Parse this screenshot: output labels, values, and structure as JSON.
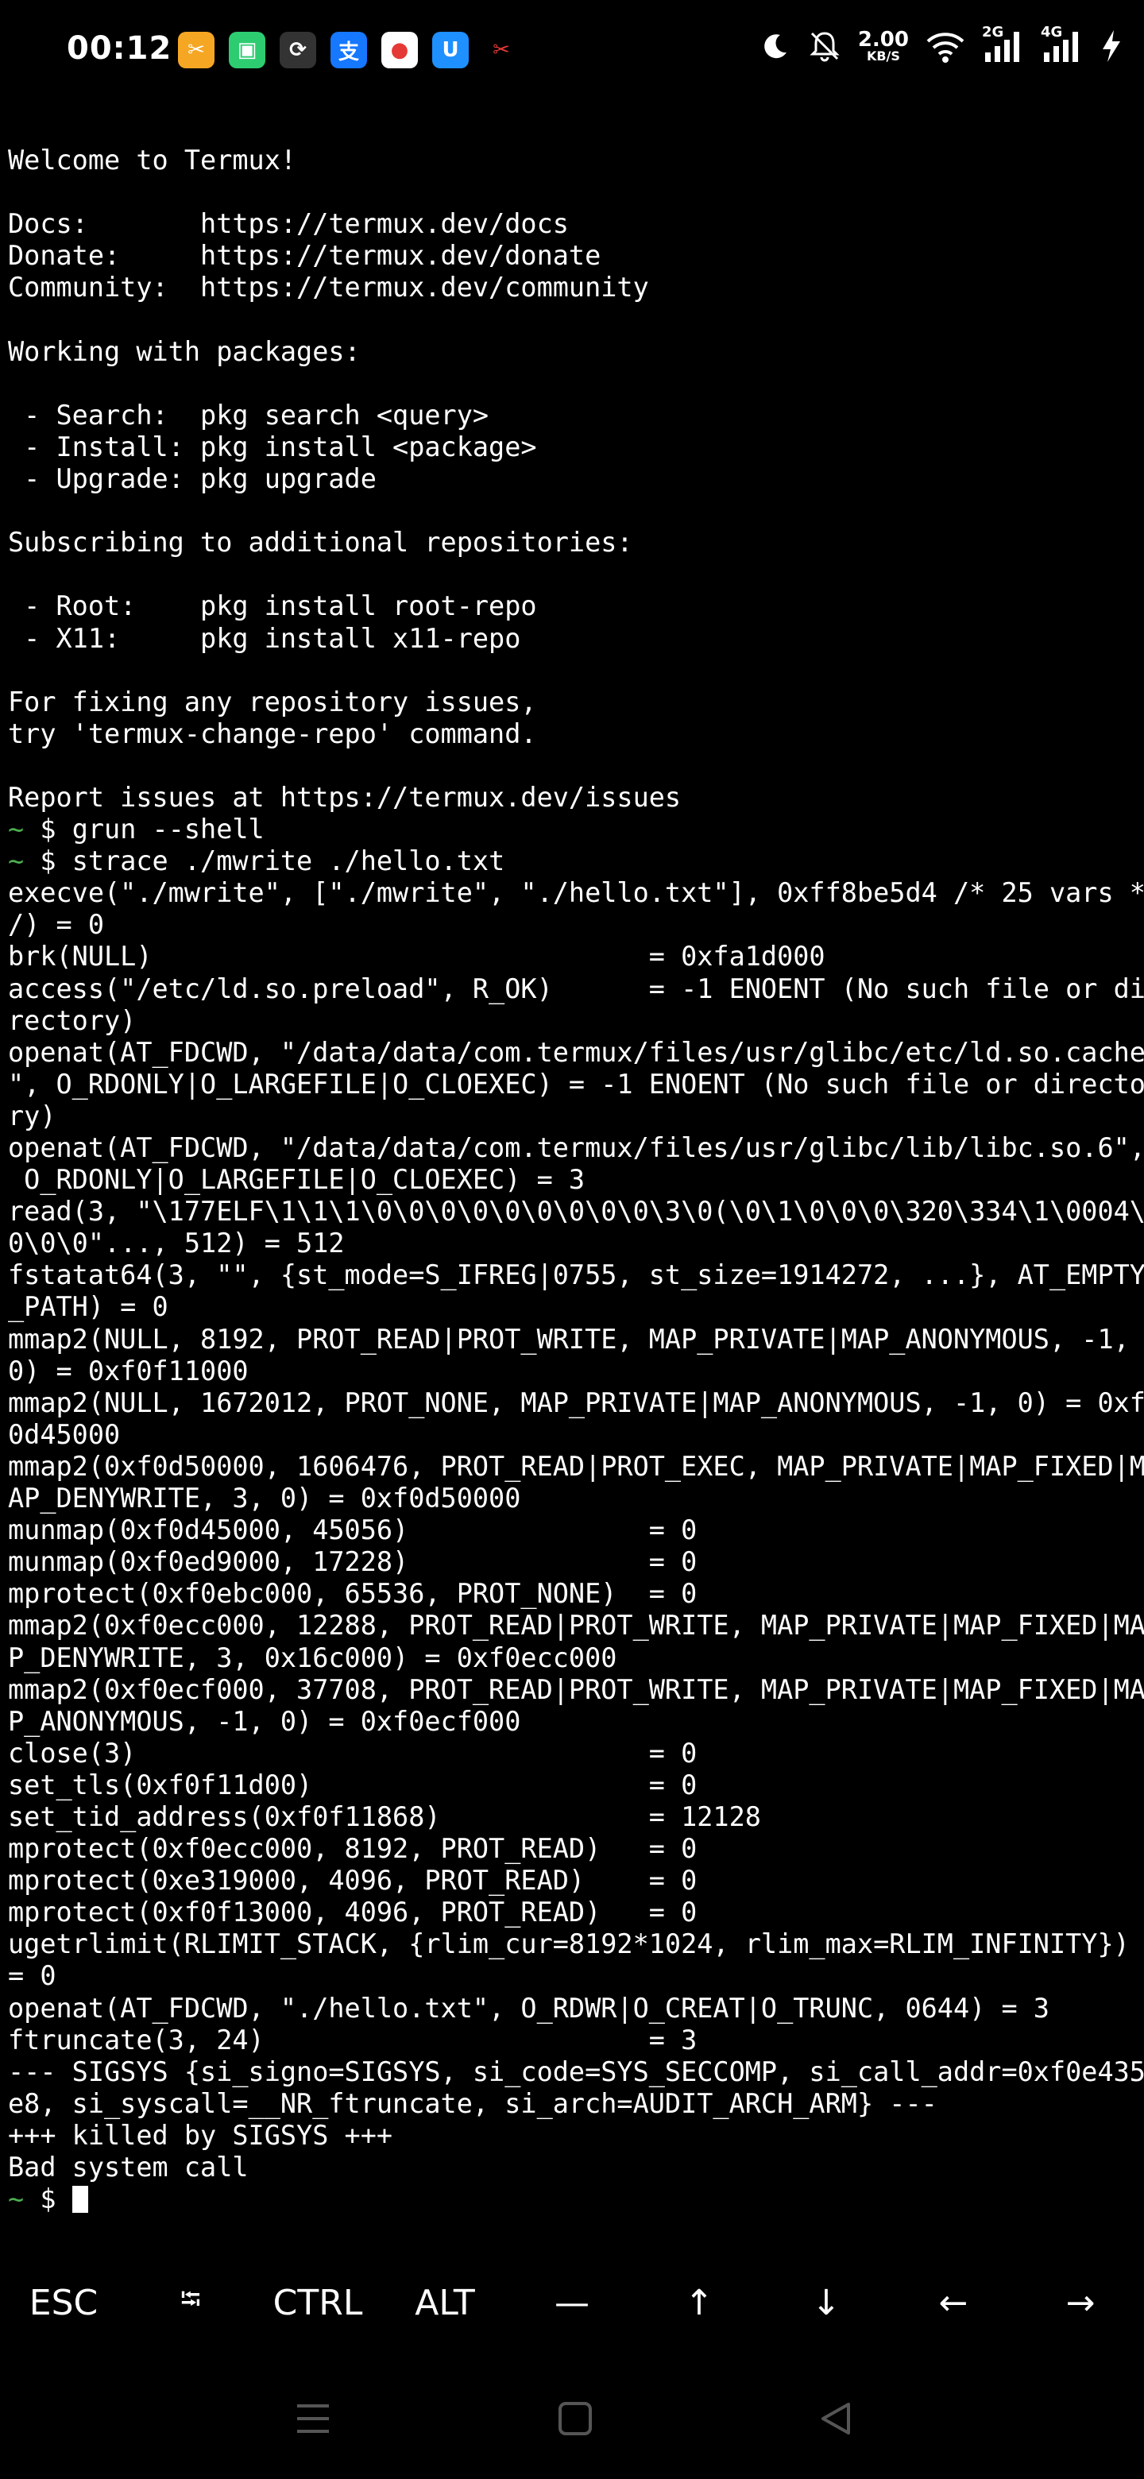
{
  "status_bar": {
    "time": "00:12",
    "net_speed_value": "2.00",
    "net_speed_unit": "KB/S",
    "sim1_label": "2G",
    "sim2_label": "4G",
    "notification_icons": [
      {
        "name": "app-notification-icon",
        "color": "#f5a623",
        "glyph": "✂"
      },
      {
        "name": "chat-notification-icon",
        "color": "#2ecc71",
        "glyph": "▣"
      },
      {
        "name": "sync-notification-icon",
        "color": "#333333",
        "glyph": "⟳"
      },
      {
        "name": "alipay-notification-icon",
        "color": "#1677ff",
        "glyph": "支"
      },
      {
        "name": "maps-notification-icon",
        "color": "#ffffff",
        "glyph": "●"
      },
      {
        "name": "store-notification-icon",
        "color": "#1e90ff",
        "glyph": "U"
      },
      {
        "name": "screenshot-notification-icon",
        "color": "#000000",
        "glyph": "✂"
      }
    ]
  },
  "terminal": {
    "lines": [
      "",
      "Welcome to Termux!",
      "",
      "Docs:       https://termux.dev/docs",
      "Donate:     https://termux.dev/donate",
      "Community:  https://termux.dev/community",
      "",
      "Working with packages:",
      "",
      " - Search:  pkg search <query>",
      " - Install: pkg install <package>",
      " - Upgrade: pkg upgrade",
      "",
      "Subscribing to additional repositories:",
      "",
      " - Root:    pkg install root-repo",
      " - X11:     pkg install x11-repo",
      "",
      "For fixing any repository issues,",
      "try 'termux-change-repo' command.",
      "",
      "Report issues at https://termux.dev/issues"
    ],
    "prompt_symbol": "~",
    "prompt_dollar": " $ ",
    "commands": [
      "grun --shell",
      "strace ./mwrite ./hello.txt"
    ],
    "output_lines": [
      "execve(\"./mwrite\", [\"./mwrite\", \"./hello.txt\"], 0xff8be5d4 /* 25 vars *",
      "/) = 0",
      "brk(NULL)                               = 0xfa1d000",
      "access(\"/etc/ld.so.preload\", R_OK)      = -1 ENOENT (No such file or di",
      "rectory)",
      "openat(AT_FDCWD, \"/data/data/com.termux/files/usr/glibc/etc/ld.so.cache",
      "\", O_RDONLY|O_LARGEFILE|O_CLOEXEC) = -1 ENOENT (No such file or directo",
      "ry)",
      "openat(AT_FDCWD, \"/data/data/com.termux/files/usr/glibc/lib/libc.so.6\",",
      " O_RDONLY|O_LARGEFILE|O_CLOEXEC) = 3",
      "read(3, \"\\177ELF\\1\\1\\1\\0\\0\\0\\0\\0\\0\\0\\0\\0\\3\\0(\\0\\1\\0\\0\\0\\320\\334\\1\\0004\\",
      "0\\0\\0\"..., 512) = 512",
      "fstatat64(3, \"\", {st_mode=S_IFREG|0755, st_size=1914272, ...}, AT_EMPTY",
      "_PATH) = 0",
      "mmap2(NULL, 8192, PROT_READ|PROT_WRITE, MAP_PRIVATE|MAP_ANONYMOUS, -1,",
      "0) = 0xf0f11000",
      "mmap2(NULL, 1672012, PROT_NONE, MAP_PRIVATE|MAP_ANONYMOUS, -1, 0) = 0xf",
      "0d45000",
      "mmap2(0xf0d50000, 1606476, PROT_READ|PROT_EXEC, MAP_PRIVATE|MAP_FIXED|M",
      "AP_DENYWRITE, 3, 0) = 0xf0d50000",
      "munmap(0xf0d45000, 45056)               = 0",
      "munmap(0xf0ed9000, 17228)               = 0",
      "mprotect(0xf0ebc000, 65536, PROT_NONE)  = 0",
      "mmap2(0xf0ecc000, 12288, PROT_READ|PROT_WRITE, MAP_PRIVATE|MAP_FIXED|MA",
      "P_DENYWRITE, 3, 0x16c000) = 0xf0ecc000",
      "mmap2(0xf0ecf000, 37708, PROT_READ|PROT_WRITE, MAP_PRIVATE|MAP_FIXED|MA",
      "P_ANONYMOUS, -1, 0) = 0xf0ecf000",
      "close(3)                                = 0",
      "set_tls(0xf0f11d00)                     = 0",
      "set_tid_address(0xf0f11868)             = 12128",
      "mprotect(0xf0ecc000, 8192, PROT_READ)   = 0",
      "mprotect(0xe319000, 4096, PROT_READ)    = 0",
      "mprotect(0xf0f13000, 4096, PROT_READ)   = 0",
      "ugetrlimit(RLIMIT_STACK, {rlim_cur=8192*1024, rlim_max=RLIM_INFINITY})",
      "= 0",
      "openat(AT_FDCWD, \"./hello.txt\", O_RDWR|O_CREAT|O_TRUNC, 0644) = 3",
      "ftruncate(3, 24)                        = 3",
      "--- SIGSYS {si_signo=SIGSYS, si_code=SYS_SECCOMP, si_call_addr=0xf0e435",
      "e8, si_syscall=__NR_ftruncate, si_arch=AUDIT_ARCH_ARM} ---",
      "+++ killed by SIGSYS +++",
      "Bad system call"
    ]
  },
  "extra_keys": [
    {
      "name": "esc-key",
      "label": "ESC"
    },
    {
      "name": "tab-key",
      "label": "⭾",
      "small": true
    },
    {
      "name": "ctrl-key",
      "label": "CTRL"
    },
    {
      "name": "alt-key",
      "label": "ALT"
    },
    {
      "name": "dash-key",
      "label": "—"
    },
    {
      "name": "arrow-up-key",
      "label": "↑"
    },
    {
      "name": "arrow-down-key",
      "label": "↓"
    },
    {
      "name": "arrow-left-key",
      "label": "←"
    },
    {
      "name": "arrow-right-key",
      "label": "→"
    }
  ],
  "colors": {
    "background": "#000000",
    "foreground": "#ffffff",
    "prompt": "#4caf50",
    "nav_icon": "#555555"
  }
}
